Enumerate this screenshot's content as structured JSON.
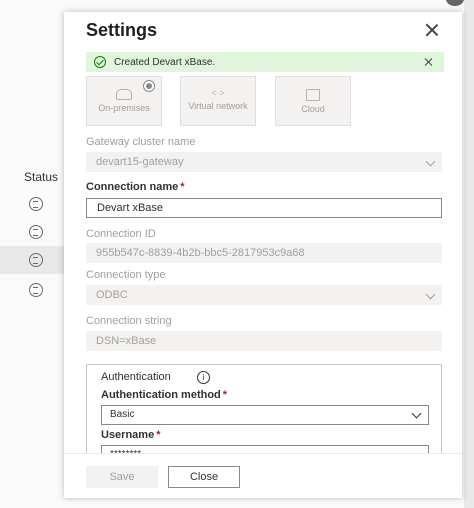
{
  "background": {
    "status_header": "Status",
    "rows": [
      "",
      "",
      "",
      ""
    ]
  },
  "panel": {
    "title": "Settings",
    "banner_text": "Created Devart xBase.",
    "tiles": [
      {
        "label": "On-premises",
        "icon": "gateway-icon",
        "selected": true
      },
      {
        "label": "Virtual network",
        "icon": "virtual-network-icon",
        "selected": false
      },
      {
        "label": "Cloud",
        "icon": "cloud-icon",
        "selected": false
      }
    ],
    "gateway_cluster": {
      "label": "Gateway cluster name",
      "value": "devart15-gateway"
    },
    "connection_name": {
      "label": "Connection name",
      "required_mark": "*",
      "value": "Devart xBase"
    },
    "connection_id": {
      "label": "Connection ID",
      "value": "955b547c-8839-4b2b-bbc5-2817953c9a68"
    },
    "connection_type": {
      "label": "Connection type",
      "value": "ODBC"
    },
    "connection_string": {
      "label": "Connection string",
      "value": "DSN=xBase"
    },
    "authentication": {
      "title": "Authentication",
      "method_label": "Authentication method",
      "method_required": "*",
      "method_value": "Basic",
      "username_label": "Username",
      "username_required": "*",
      "username_value": "********"
    },
    "buttons": {
      "save": "Save",
      "close": "Close"
    }
  },
  "colors": {
    "success_bg": "#dff6dd",
    "success_icon": "#107c10",
    "required": "#a4262c"
  }
}
